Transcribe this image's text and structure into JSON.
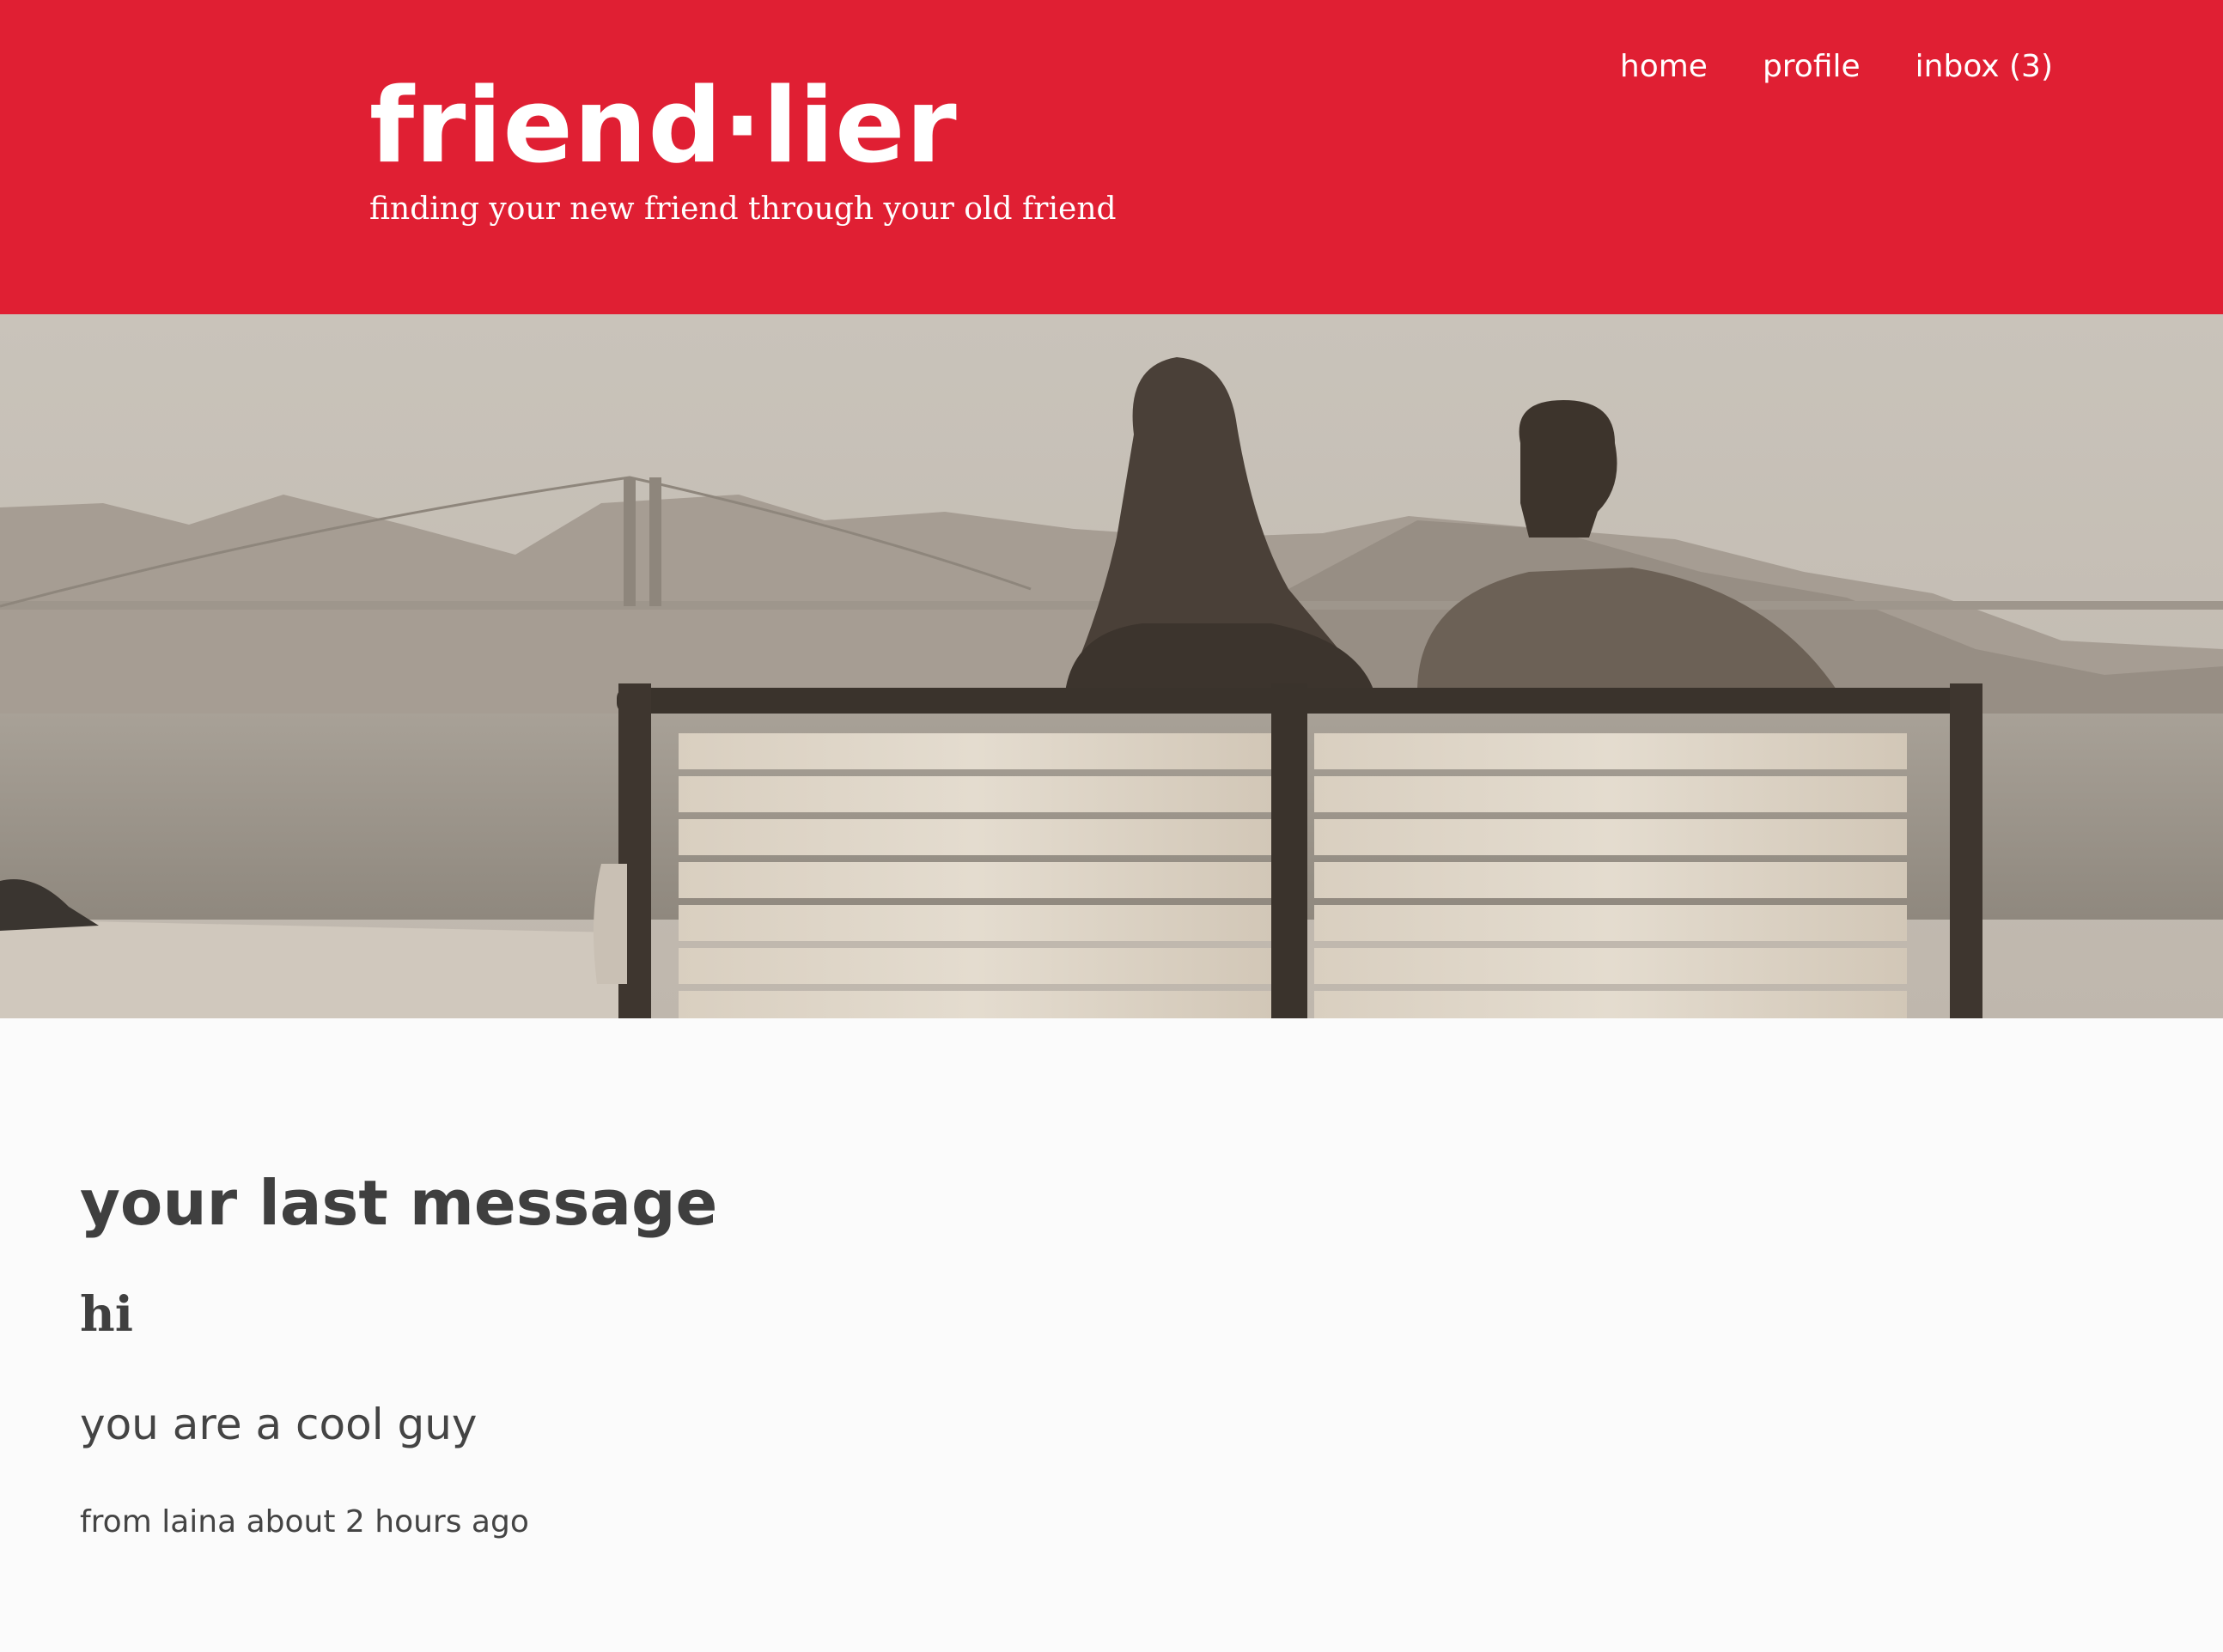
{
  "header": {
    "brand": "friend·lier",
    "tagline": "finding your new friend through your old friend",
    "background_color": "#e01f33"
  },
  "nav": {
    "home": "home",
    "profile": "profile",
    "inbox": "inbox (3)"
  },
  "hero": {
    "image": "sepia photo of a couple sitting on a bench facing the bay and the Golden Gate Bridge"
  },
  "message": {
    "section_title": "your last message",
    "subject": "hi",
    "body": "you are a cool guy",
    "meta": "from laina about 2 hours ago"
  }
}
